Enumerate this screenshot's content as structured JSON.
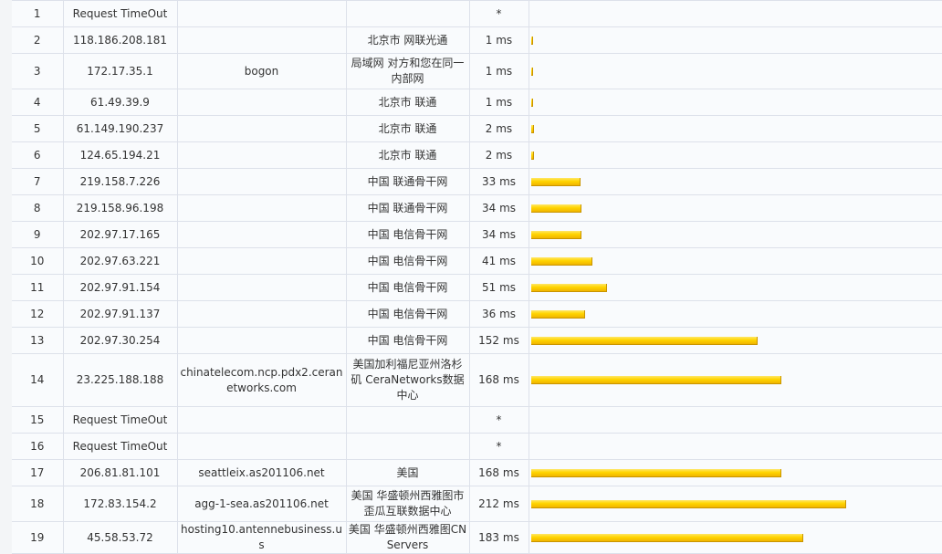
{
  "rows": [
    {
      "hop": "1",
      "ip": "Request TimeOut",
      "host": "",
      "location": "",
      "latency": "*",
      "latency_ms": null
    },
    {
      "hop": "2",
      "ip": "118.186.208.181",
      "host": "",
      "location": "北京市 网联光通",
      "latency": "1 ms",
      "latency_ms": 1
    },
    {
      "hop": "3",
      "ip": "172.17.35.1",
      "host": "bogon",
      "location": "局域网 对方和您在同一内部网",
      "latency": "1 ms",
      "latency_ms": 1
    },
    {
      "hop": "4",
      "ip": "61.49.39.9",
      "host": "",
      "location": "北京市 联通",
      "latency": "1 ms",
      "latency_ms": 1
    },
    {
      "hop": "5",
      "ip": "61.149.190.237",
      "host": "",
      "location": "北京市 联通",
      "latency": "2 ms",
      "latency_ms": 2
    },
    {
      "hop": "6",
      "ip": "124.65.194.21",
      "host": "",
      "location": "北京市 联通",
      "latency": "2 ms",
      "latency_ms": 2
    },
    {
      "hop": "7",
      "ip": "219.158.7.226",
      "host": "",
      "location": "中国 联通骨干网",
      "latency": "33 ms",
      "latency_ms": 33
    },
    {
      "hop": "8",
      "ip": "219.158.96.198",
      "host": "",
      "location": "中国 联通骨干网",
      "latency": "34 ms",
      "latency_ms": 34
    },
    {
      "hop": "9",
      "ip": "202.97.17.165",
      "host": "",
      "location": "中国 电信骨干网",
      "latency": "34 ms",
      "latency_ms": 34
    },
    {
      "hop": "10",
      "ip": "202.97.63.221",
      "host": "",
      "location": "中国 电信骨干网",
      "latency": "41 ms",
      "latency_ms": 41
    },
    {
      "hop": "11",
      "ip": "202.97.91.154",
      "host": "",
      "location": "中国 电信骨干网",
      "latency": "51 ms",
      "latency_ms": 51
    },
    {
      "hop": "12",
      "ip": "202.97.91.137",
      "host": "",
      "location": "中国 电信骨干网",
      "latency": "36 ms",
      "latency_ms": 36
    },
    {
      "hop": "13",
      "ip": "202.97.30.254",
      "host": "",
      "location": "中国 电信骨干网",
      "latency": "152 ms",
      "latency_ms": 152
    },
    {
      "hop": "14",
      "ip": "23.225.188.188",
      "host": "chinatelecom.ncp.pdx2.ceranetworks.com",
      "location": "美国加利福尼亚州洛杉矶 CeraNetworks数据中心",
      "latency": "168 ms",
      "latency_ms": 168
    },
    {
      "hop": "15",
      "ip": "Request TimeOut",
      "host": "",
      "location": "",
      "latency": "*",
      "latency_ms": null
    },
    {
      "hop": "16",
      "ip": "Request TimeOut",
      "host": "",
      "location": "",
      "latency": "*",
      "latency_ms": null
    },
    {
      "hop": "17",
      "ip": "206.81.81.101",
      "host": "seattleix.as201106.net",
      "location": "美国",
      "latency": "168 ms",
      "latency_ms": 168
    },
    {
      "hop": "18",
      "ip": "172.83.154.2",
      "host": "agg-1-sea.as201106.net",
      "location": "美国 华盛顿州西雅图市歪瓜互联数据中心",
      "latency": "212 ms",
      "latency_ms": 212
    },
    {
      "hop": "19",
      "ip": "45.58.53.72",
      "host": "hosting10.antennebusiness.us",
      "location": "美国 华盛顿州西雅图CN Servers",
      "latency": "183 ms",
      "latency_ms": 183
    }
  ],
  "bar_scale_max_ms": 278,
  "colors": {
    "bar": "#ffd500",
    "border": "#dde1ea",
    "cell_bg": "#f9fbfd"
  }
}
